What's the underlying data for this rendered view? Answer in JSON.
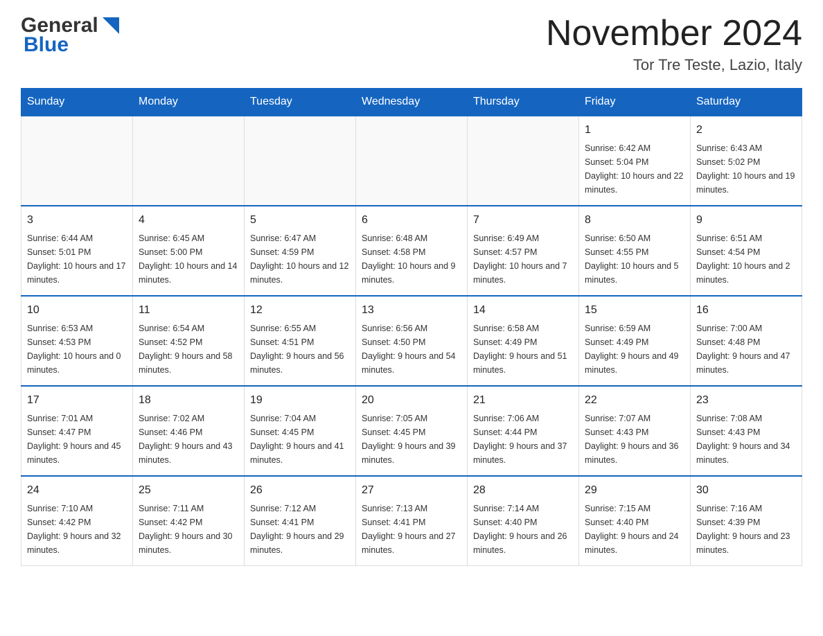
{
  "header": {
    "logo_text_general": "General",
    "logo_text_blue": "Blue",
    "month_title": "November 2024",
    "location": "Tor Tre Teste, Lazio, Italy"
  },
  "weekdays": [
    "Sunday",
    "Monday",
    "Tuesday",
    "Wednesday",
    "Thursday",
    "Friday",
    "Saturday"
  ],
  "weeks": [
    [
      {
        "day": "",
        "sunrise": "",
        "sunset": "",
        "daylight": ""
      },
      {
        "day": "",
        "sunrise": "",
        "sunset": "",
        "daylight": ""
      },
      {
        "day": "",
        "sunrise": "",
        "sunset": "",
        "daylight": ""
      },
      {
        "day": "",
        "sunrise": "",
        "sunset": "",
        "daylight": ""
      },
      {
        "day": "",
        "sunrise": "",
        "sunset": "",
        "daylight": ""
      },
      {
        "day": "1",
        "sunrise": "Sunrise: 6:42 AM",
        "sunset": "Sunset: 5:04 PM",
        "daylight": "Daylight: 10 hours and 22 minutes."
      },
      {
        "day": "2",
        "sunrise": "Sunrise: 6:43 AM",
        "sunset": "Sunset: 5:02 PM",
        "daylight": "Daylight: 10 hours and 19 minutes."
      }
    ],
    [
      {
        "day": "3",
        "sunrise": "Sunrise: 6:44 AM",
        "sunset": "Sunset: 5:01 PM",
        "daylight": "Daylight: 10 hours and 17 minutes."
      },
      {
        "day": "4",
        "sunrise": "Sunrise: 6:45 AM",
        "sunset": "Sunset: 5:00 PM",
        "daylight": "Daylight: 10 hours and 14 minutes."
      },
      {
        "day": "5",
        "sunrise": "Sunrise: 6:47 AM",
        "sunset": "Sunset: 4:59 PM",
        "daylight": "Daylight: 10 hours and 12 minutes."
      },
      {
        "day": "6",
        "sunrise": "Sunrise: 6:48 AM",
        "sunset": "Sunset: 4:58 PM",
        "daylight": "Daylight: 10 hours and 9 minutes."
      },
      {
        "day": "7",
        "sunrise": "Sunrise: 6:49 AM",
        "sunset": "Sunset: 4:57 PM",
        "daylight": "Daylight: 10 hours and 7 minutes."
      },
      {
        "day": "8",
        "sunrise": "Sunrise: 6:50 AM",
        "sunset": "Sunset: 4:55 PM",
        "daylight": "Daylight: 10 hours and 5 minutes."
      },
      {
        "day": "9",
        "sunrise": "Sunrise: 6:51 AM",
        "sunset": "Sunset: 4:54 PM",
        "daylight": "Daylight: 10 hours and 2 minutes."
      }
    ],
    [
      {
        "day": "10",
        "sunrise": "Sunrise: 6:53 AM",
        "sunset": "Sunset: 4:53 PM",
        "daylight": "Daylight: 10 hours and 0 minutes."
      },
      {
        "day": "11",
        "sunrise": "Sunrise: 6:54 AM",
        "sunset": "Sunset: 4:52 PM",
        "daylight": "Daylight: 9 hours and 58 minutes."
      },
      {
        "day": "12",
        "sunrise": "Sunrise: 6:55 AM",
        "sunset": "Sunset: 4:51 PM",
        "daylight": "Daylight: 9 hours and 56 minutes."
      },
      {
        "day": "13",
        "sunrise": "Sunrise: 6:56 AM",
        "sunset": "Sunset: 4:50 PM",
        "daylight": "Daylight: 9 hours and 54 minutes."
      },
      {
        "day": "14",
        "sunrise": "Sunrise: 6:58 AM",
        "sunset": "Sunset: 4:49 PM",
        "daylight": "Daylight: 9 hours and 51 minutes."
      },
      {
        "day": "15",
        "sunrise": "Sunrise: 6:59 AM",
        "sunset": "Sunset: 4:49 PM",
        "daylight": "Daylight: 9 hours and 49 minutes."
      },
      {
        "day": "16",
        "sunrise": "Sunrise: 7:00 AM",
        "sunset": "Sunset: 4:48 PM",
        "daylight": "Daylight: 9 hours and 47 minutes."
      }
    ],
    [
      {
        "day": "17",
        "sunrise": "Sunrise: 7:01 AM",
        "sunset": "Sunset: 4:47 PM",
        "daylight": "Daylight: 9 hours and 45 minutes."
      },
      {
        "day": "18",
        "sunrise": "Sunrise: 7:02 AM",
        "sunset": "Sunset: 4:46 PM",
        "daylight": "Daylight: 9 hours and 43 minutes."
      },
      {
        "day": "19",
        "sunrise": "Sunrise: 7:04 AM",
        "sunset": "Sunset: 4:45 PM",
        "daylight": "Daylight: 9 hours and 41 minutes."
      },
      {
        "day": "20",
        "sunrise": "Sunrise: 7:05 AM",
        "sunset": "Sunset: 4:45 PM",
        "daylight": "Daylight: 9 hours and 39 minutes."
      },
      {
        "day": "21",
        "sunrise": "Sunrise: 7:06 AM",
        "sunset": "Sunset: 4:44 PM",
        "daylight": "Daylight: 9 hours and 37 minutes."
      },
      {
        "day": "22",
        "sunrise": "Sunrise: 7:07 AM",
        "sunset": "Sunset: 4:43 PM",
        "daylight": "Daylight: 9 hours and 36 minutes."
      },
      {
        "day": "23",
        "sunrise": "Sunrise: 7:08 AM",
        "sunset": "Sunset: 4:43 PM",
        "daylight": "Daylight: 9 hours and 34 minutes."
      }
    ],
    [
      {
        "day": "24",
        "sunrise": "Sunrise: 7:10 AM",
        "sunset": "Sunset: 4:42 PM",
        "daylight": "Daylight: 9 hours and 32 minutes."
      },
      {
        "day": "25",
        "sunrise": "Sunrise: 7:11 AM",
        "sunset": "Sunset: 4:42 PM",
        "daylight": "Daylight: 9 hours and 30 minutes."
      },
      {
        "day": "26",
        "sunrise": "Sunrise: 7:12 AM",
        "sunset": "Sunset: 4:41 PM",
        "daylight": "Daylight: 9 hours and 29 minutes."
      },
      {
        "day": "27",
        "sunrise": "Sunrise: 7:13 AM",
        "sunset": "Sunset: 4:41 PM",
        "daylight": "Daylight: 9 hours and 27 minutes."
      },
      {
        "day": "28",
        "sunrise": "Sunrise: 7:14 AM",
        "sunset": "Sunset: 4:40 PM",
        "daylight": "Daylight: 9 hours and 26 minutes."
      },
      {
        "day": "29",
        "sunrise": "Sunrise: 7:15 AM",
        "sunset": "Sunset: 4:40 PM",
        "daylight": "Daylight: 9 hours and 24 minutes."
      },
      {
        "day": "30",
        "sunrise": "Sunrise: 7:16 AM",
        "sunset": "Sunset: 4:39 PM",
        "daylight": "Daylight: 9 hours and 23 minutes."
      }
    ]
  ],
  "colors": {
    "header_bg": "#1565C0",
    "header_text": "#ffffff",
    "border": "#1565C0",
    "cell_border": "#cccccc"
  }
}
